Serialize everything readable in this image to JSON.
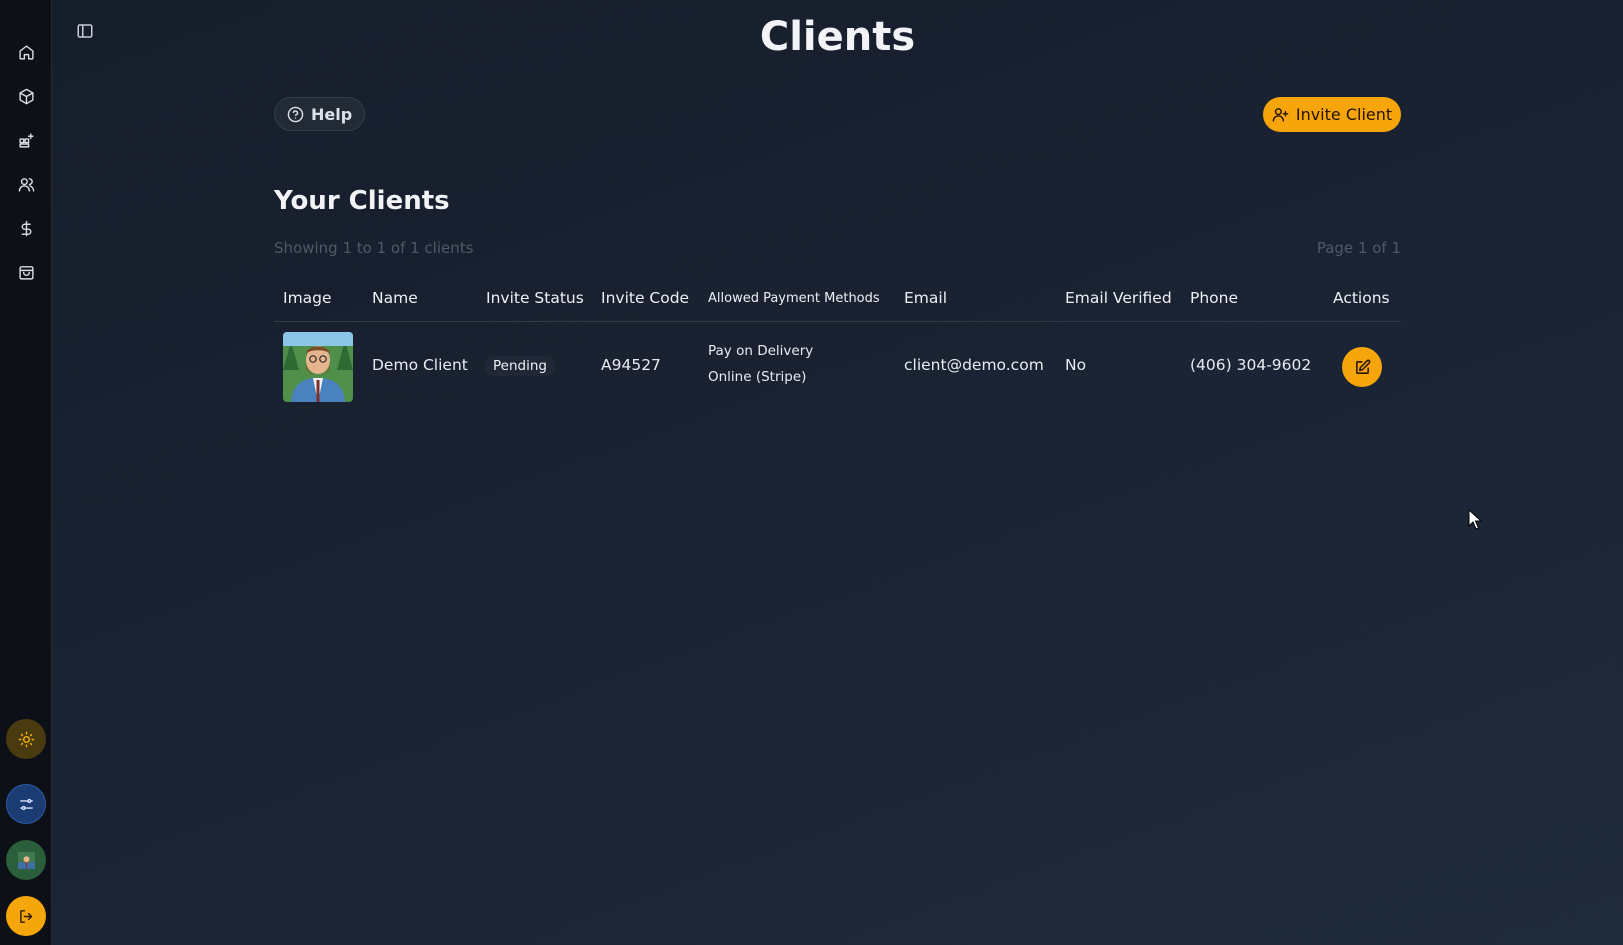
{
  "page": {
    "title": "Clients"
  },
  "sidebar": {
    "items": [
      {
        "name": "home",
        "icon": "home-icon"
      },
      {
        "name": "products",
        "icon": "package-icon"
      },
      {
        "name": "categories",
        "icon": "grid-plus-icon"
      },
      {
        "name": "clients",
        "icon": "users-icon"
      },
      {
        "name": "payments",
        "icon": "dollar-icon"
      },
      {
        "name": "orders",
        "icon": "shopping-bag-icon"
      }
    ]
  },
  "toolbar": {
    "help_label": "Help",
    "invite_label": "Invite Client"
  },
  "clients": {
    "section_title": "Your Clients",
    "showing_text": "Showing 1 to 1 of 1 clients",
    "page_text": "Page 1 of 1",
    "columns": [
      "Image",
      "Name",
      "Invite Status",
      "Invite Code",
      "Allowed Payment Methods",
      "Email",
      "Email Verified",
      "Phone",
      "Actions"
    ],
    "rows": [
      {
        "name": "Demo Client",
        "invite_status": "Pending",
        "invite_code": "A94527",
        "payment_methods": [
          "Pay on Delivery",
          "Online (Stripe)"
        ],
        "email": "client@demo.com",
        "email_verified": "No",
        "phone": "(406) 304-9602"
      }
    ]
  },
  "colors": {
    "accent": "#f6a50b",
    "background": "#1b2434",
    "sidebar": "#0d1017"
  }
}
